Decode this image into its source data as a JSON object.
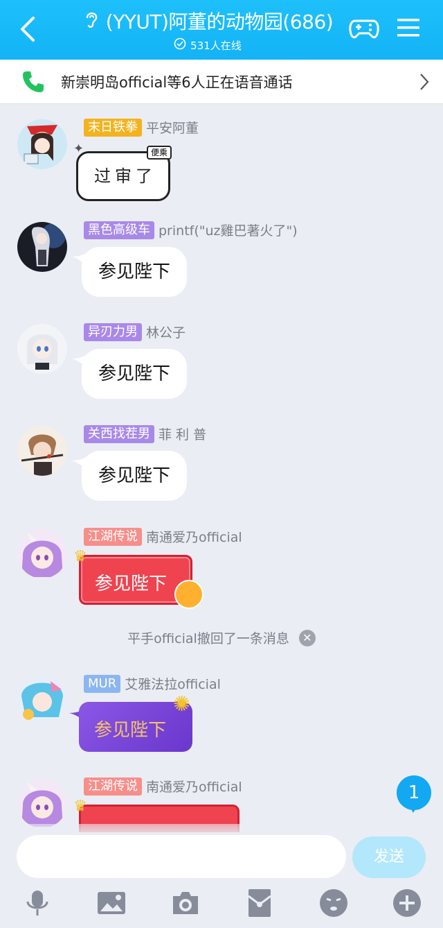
{
  "header": {
    "title": "(YYUT)阿董的动物园(686)",
    "online_count": "531人在线",
    "accent_color": "#16b7f8",
    "icons": [
      "back-arrow-icon",
      "ear-icon",
      "online-check-icon",
      "gamepad-icon",
      "menu-icon"
    ]
  },
  "voice_call": {
    "text": "新崇明岛official等6人正在语音通话",
    "icons": [
      "phone-icon",
      "chevron-right-icon"
    ]
  },
  "messages": [
    {
      "badge": "末日铁拳",
      "badge_color": "#f3b31f",
      "sender": "平安阿董",
      "text": "过审了",
      "style": "sticker"
    },
    {
      "badge": "黑色高级车",
      "badge_color": "#a989e8",
      "sender": "printf(\"uz雞巴著火了\")",
      "text": "参见陛下",
      "style": "plain"
    },
    {
      "badge": "异刃力男",
      "badge_color": "#a989e8",
      "sender": "林公子",
      "text": "参见陛下",
      "style": "plain"
    },
    {
      "badge": "关西找茬男",
      "badge_color": "#a989e8",
      "sender": "菲 利 普",
      "text": "参见陛下",
      "style": "plain"
    },
    {
      "badge": "江湖传说",
      "badge_color": "#f78e8a",
      "sender": "南通爱乃official",
      "text": "参见陛下",
      "style": "red"
    },
    {
      "badge": "MUR",
      "badge_color": "#8cb6f0",
      "sender": "艾雅法拉official",
      "text": "参见陛下",
      "style": "purple"
    },
    {
      "badge": "江湖传说",
      "badge_color": "#f78e8a",
      "sender": "南通爱乃official",
      "text": "",
      "style": "red-partial"
    }
  ],
  "system_note": "平手official撤回了一条消息",
  "unread_count": "1",
  "composer": {
    "placeholder": "",
    "send_label": "发送"
  },
  "toolbar_icons": [
    "microphone-icon",
    "image-icon",
    "camera-icon",
    "red-packet-icon",
    "emoji-icon",
    "plus-icon"
  ]
}
